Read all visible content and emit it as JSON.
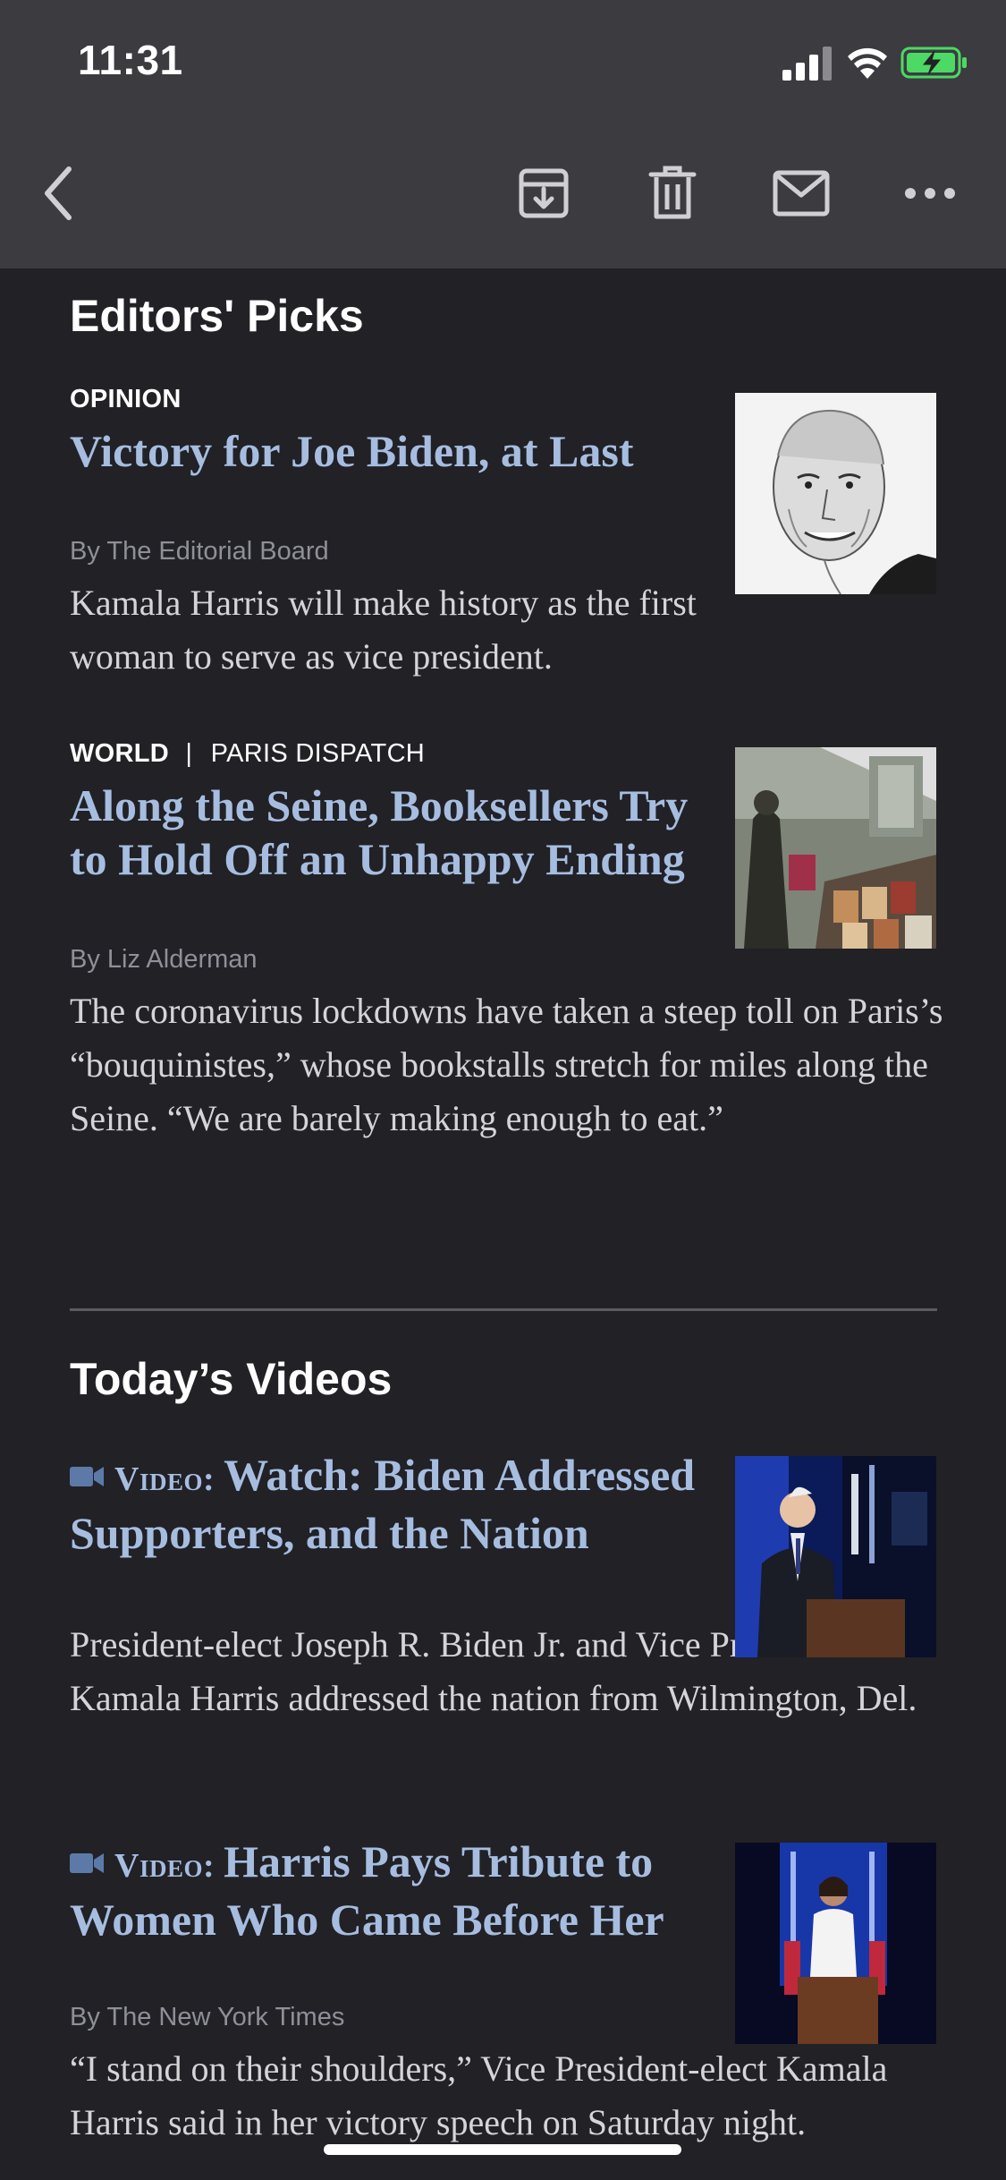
{
  "status_bar": {
    "time": "11:31"
  },
  "toolbar": {
    "back_icon": "chevron-left-icon",
    "archive_icon": "archive-icon",
    "trash_icon": "trash-icon",
    "mail_icon": "mail-icon",
    "more_icon": "more-icon"
  },
  "editors_picks": {
    "title": "Editors' Picks",
    "articles": [
      {
        "kicker": "OPINION",
        "headline": "Victory for Joe Biden, at Last",
        "byline": "By The Editorial Board",
        "summary": "Kamala Harris will make history as the first woman to serve as vice president."
      },
      {
        "kicker": "WORLD",
        "kicker_sep": "|",
        "kicker_sub": "PARIS DISPATCH",
        "headline": "Along the Seine, Booksellers Try to Hold Off an Unhappy Ending",
        "byline": "By Liz Alderman",
        "summary": "The coronavirus lockdowns have taken a steep toll on Paris’s “bouquinistes,” whose bookstalls stretch for miles along the Seine. “We are barely making enough to eat.”"
      }
    ]
  },
  "todays_videos": {
    "title": "Today’s Videos",
    "videos": [
      {
        "tag": "Video:",
        "headline": "Watch: Biden Addressed Supporters, and the Nation",
        "summary": "President-elect Joseph R. Biden Jr. and Vice President-elect Kamala Harris addressed the nation from Wilmington, Del."
      },
      {
        "tag": "Video:",
        "headline": "Harris Pays Tribute to Women Who Came Before Her",
        "byline": "By The New York Times",
        "summary": "“I stand on their shoulders,” Vice President-elect Kamala Harris said in her victory speech on Saturday night."
      }
    ]
  },
  "colors": {
    "background": "#212126",
    "toolbar": "#3b3b40",
    "headline": "#a6bde0",
    "battery_green": "#4cd964"
  }
}
